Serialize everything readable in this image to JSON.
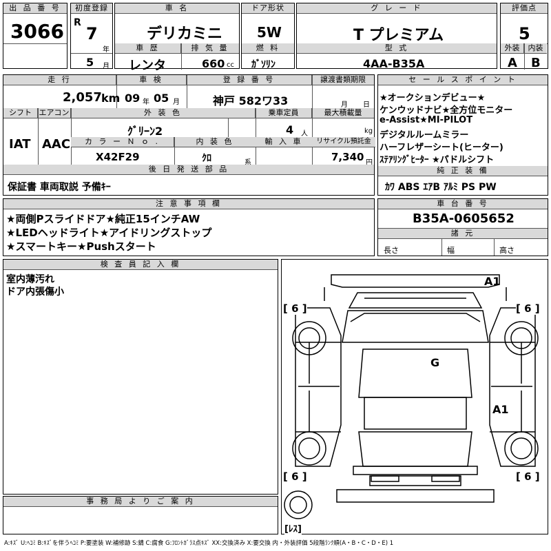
{
  "header": {
    "lot_label": "出 品 番 号",
    "lot_number": "3066",
    "first_reg_label": "初度登録",
    "era": "R",
    "year": "7",
    "year_unit": "年",
    "month": "5",
    "month_unit": "月",
    "car_name_label": "車 名",
    "car_name": "デリカミニ",
    "door_label": "ドア形状",
    "door": "5W",
    "grade_label": "グ レ ー ド",
    "grade": "T プレミアム",
    "score_label": "評価点",
    "score": "5",
    "history_label": "車 歴",
    "history": "レンタ",
    "displacement_label": "排 気 量",
    "displacement": "660",
    "displacement_unit": "cc",
    "fuel_label": "燃 料",
    "fuel": "ｶﾞｿﾘﾝ",
    "model_label": "型 式",
    "model": "4AA-B35A",
    "exterior_label": "外装",
    "exterior": "A",
    "interior_label": "内装",
    "interior": "B"
  },
  "row2": {
    "mileage_label": "走 行",
    "mileage": "2,057",
    "mileage_unit": "km",
    "inspection_label": "車 検",
    "insp_year": "09",
    "insp_year_unit": "年",
    "insp_month": "05",
    "insp_month_unit": "月",
    "plate_label": "登 録 番 号",
    "plate": "神戸 582ワ33",
    "transfer_label": "譲渡書類期限",
    "transfer_month_unit": "月",
    "transfer_day_unit": "日",
    "shift_label": "シフト",
    "shift": "IAT",
    "ac_label": "エアコン",
    "ac": "AAC",
    "color_label": "外 装 色",
    "color": "ｸﾞﾘｰﾝ2",
    "capacity_label": "乗車定員",
    "capacity": "4",
    "capacity_unit": "人",
    "load_label": "最大積載量",
    "load_unit": "kg",
    "color_no_label": "カ ラ ー Ｎ ｏ .",
    "color_no": "X42F29",
    "interior_color_label": "内 装 色",
    "interior_color": "ｸﾛ",
    "interior_color_unit": "系",
    "import_label": "輸 入 車",
    "recycle_label": "リサイクル預託金",
    "recycle": "7,340",
    "recycle_unit": "円",
    "later_label": "後 日 発 送 部 品",
    "later": "保証書 車両取説 予備ｷｰ"
  },
  "sales_points": {
    "label": "セ ー ル ス ポ イ ン ト",
    "lines": [
      "★オークションデビュー★",
      "ケンウッドナビ★全方位モニター",
      "e-Assist★MI-PILOT",
      "デジタルルームミラー",
      "ハーフレザーシート(ヒーター)",
      "ｽﾃｱﾘﾝｸﾞﾋｰﾀｰ ★パドルシフト"
    ]
  },
  "equipment": {
    "label": "純 正 装 備",
    "items": "ｶﾜ ABS ｴｱB ｱﾙﾐ PS PW"
  },
  "notes": {
    "label": "注 意 事 項 欄",
    "lines": [
      "★両側Pスライドドア★純正15インチAW",
      "★LEDヘッドライト★アイドリングストップ",
      "★スマートキー★Pushスタート"
    ]
  },
  "chassis": {
    "label": "車 台 番 号",
    "number": "B35A-0605652",
    "dims_label": "諸 元",
    "length": "長さ",
    "width": "幅",
    "height": "高さ"
  },
  "inspector": {
    "label": "検 査 員 記 入 欄",
    "lines": [
      "室内薄汚れ",
      "ドア内張傷小"
    ]
  },
  "office": {
    "label": "事 務 局 よ り ご 案 内"
  },
  "diagram": {
    "marks": [
      "A1",
      "G",
      "A1"
    ],
    "tires": [
      "[ 6 ]",
      "[ 6 ]",
      "[ 6 ]",
      "[ 6 ]",
      "[ﾚｽ]"
    ]
  },
  "legend": "A:ｷｽﾞ U:ﾍｺﾐ B:ｷｽﾞを伴うﾍｺﾐ P:要塗装 W:補修跡 S:錆 C:腐食 G:ﾌﾛﾝﾄｶﾞﾗｽ点ｷｽﾞ XX:交換済み X:要交換 内・外装評価 5段階ﾗﾝｸ順(A・B・C・D・E) 1"
}
